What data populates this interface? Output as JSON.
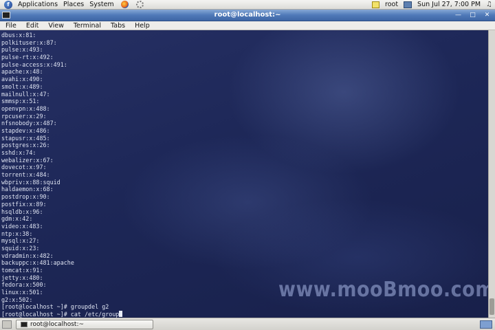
{
  "top_panel": {
    "menus": [
      "Applications",
      "Places",
      "System"
    ],
    "user": "root",
    "clock": "Sun Jul 27,  7:00 PM"
  },
  "window": {
    "title": "root@localhost:~",
    "menu": [
      "File",
      "Edit",
      "View",
      "Terminal",
      "Tabs",
      "Help"
    ]
  },
  "terminal": {
    "lines": [
      "dbus:x:81:",
      "polkituser:x:87:",
      "pulse:x:493:",
      "pulse-rt:x:492:",
      "pulse-access:x:491:",
      "apache:x:48:",
      "avahi:x:490:",
      "smolt:x:489:",
      "mailnull:x:47:",
      "smmsp:x:51:",
      "openvpn:x:488:",
      "rpcuser:x:29:",
      "nfsnobody:x:487:",
      "stapdev:x:486:",
      "stapusr:x:485:",
      "postgres:x:26:",
      "sshd:x:74:",
      "webalizer:x:67:",
      "dovecot:x:97:",
      "torrent:x:484:",
      "wbpriv:x:88:squid",
      "haldaemon:x:68:",
      "postdrop:x:90:",
      "postfix:x:89:",
      "hsqldb:x:96:",
      "gdm:x:42:",
      "video:x:483:",
      "ntp:x:38:",
      "mysql:x:27:",
      "squid:x:23:",
      "vdradmin:x:482:",
      "backuppc:x:481:apache",
      "tomcat:x:91:",
      "jetty:x:480:",
      "fedora:x:500:",
      "linux:x:501:",
      "g2:x:502:",
      "[root@localhost ~]# groupdel g2"
    ],
    "current_command": "[root@localhost ~]# cat /etc/group",
    "watermark": "www.mooBmoo.com"
  },
  "taskbar": {
    "task": "root@localhost:~"
  }
}
